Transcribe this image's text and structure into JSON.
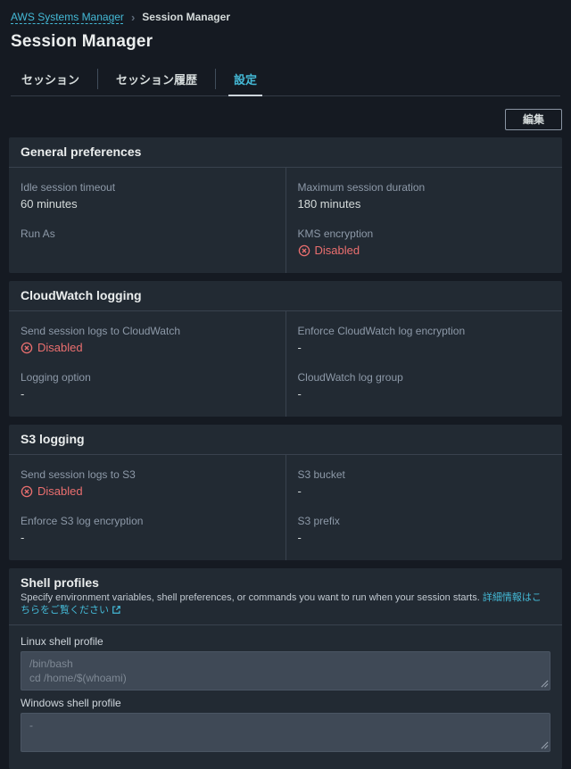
{
  "breadcrumb": {
    "link": "AWS Systems Manager",
    "separator": "›",
    "current": "Session Manager"
  },
  "page": {
    "title": "Session Manager"
  },
  "tabs": [
    {
      "label": "セッション"
    },
    {
      "label": "セッション履歴"
    },
    {
      "label": "設定"
    }
  ],
  "toolbar": {
    "edit_label": "編集"
  },
  "colors": {
    "accent": "#44b9d6",
    "error": "#eb6f6f",
    "page_bg": "#151a22",
    "card_bg": "#222a33"
  },
  "cards": {
    "general": {
      "title": "General preferences",
      "left": [
        {
          "label": "Idle session timeout",
          "value": "60 minutes"
        },
        {
          "label": "Run As",
          "value": ""
        }
      ],
      "right": [
        {
          "label": "Maximum session duration",
          "value": "180 minutes"
        },
        {
          "label": "KMS encryption",
          "value": "Disabled",
          "status": "error"
        }
      ]
    },
    "cloudwatch": {
      "title": "CloudWatch logging",
      "left": [
        {
          "label": "Send session logs to CloudWatch",
          "value": "Disabled",
          "status": "error"
        },
        {
          "label": "Logging option",
          "value": "-"
        }
      ],
      "right": [
        {
          "label": "Enforce CloudWatch log encryption",
          "value": "-"
        },
        {
          "label": "CloudWatch log group",
          "value": "-"
        }
      ]
    },
    "s3": {
      "title": "S3 logging",
      "left": [
        {
          "label": "Send session logs to S3",
          "value": "Disabled",
          "status": "error"
        },
        {
          "label": "Enforce S3 log encryption",
          "value": "-"
        }
      ],
      "right": [
        {
          "label": "S3 bucket",
          "value": "-"
        },
        {
          "label": "S3 prefix",
          "value": "-"
        }
      ]
    },
    "shell": {
      "title": "Shell profiles",
      "description": "Specify environment variables, shell preferences, or commands you want to run when your session starts.",
      "link_label": "詳細情報はこちらをご覧ください",
      "linux": {
        "label": "Linux shell profile",
        "value": "/bin/bash\ncd /home/$(whoami)"
      },
      "windows": {
        "label": "Windows shell profile",
        "value": "-"
      }
    }
  }
}
